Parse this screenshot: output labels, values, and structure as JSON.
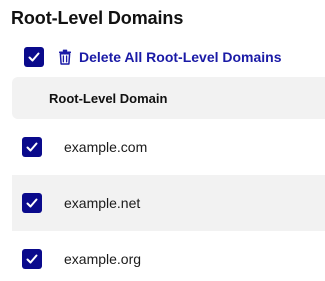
{
  "title": "Root-Level Domains",
  "actions": {
    "select_all_checked": true,
    "delete_label": "Delete All Root-Level Domains"
  },
  "table": {
    "header": "Root-Level Domain",
    "rows": [
      {
        "domain": "example.com",
        "checked": true
      },
      {
        "domain": "example.net",
        "checked": true
      },
      {
        "domain": "example.org",
        "checked": true
      }
    ]
  },
  "colors": {
    "accent": "#0a0a8c",
    "link": "#1a1aa6",
    "stripe": "#f2f2f2"
  }
}
